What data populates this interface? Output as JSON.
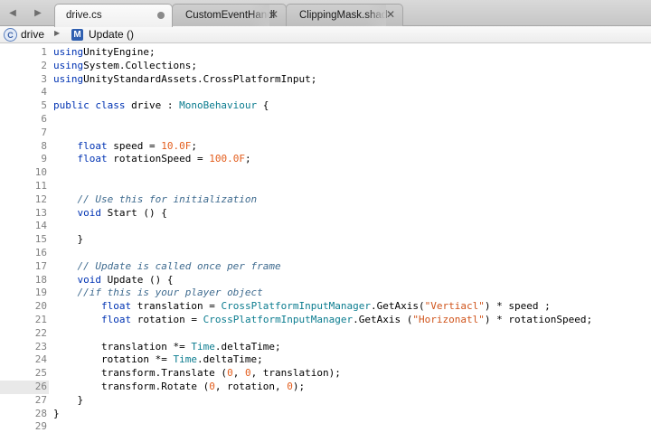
{
  "tabbar": {
    "nav_back_glyph": "◀",
    "nav_forward_glyph": "▶",
    "tabs": [
      {
        "title": "drive.cs",
        "active": true,
        "modified": true
      },
      {
        "title": "CustomEventHandl",
        "active": false,
        "close_glyph": "✕"
      },
      {
        "title": "ClippingMask.shad",
        "active": false,
        "close_glyph": "✕"
      }
    ]
  },
  "breadcrumb": {
    "class_icon_letter": "C",
    "class_name": "drive",
    "separator": "▶",
    "method_icon_letter": "M",
    "method_name": "Update ()"
  },
  "editor": {
    "current_line": 26,
    "colors": {
      "keyword": "#0033b3",
      "type": "#0b7c8f",
      "number": "#e35d1c",
      "string": "#d0541b",
      "comment": "#3f6b8f",
      "line_number": "#808080",
      "current_line_gutter": "#e9e9e9"
    },
    "lines": [
      {
        "n": "1",
        "tokens": [
          [
            "kw",
            "using"
          ],
          [
            "",
            "UnityEngine;"
          ]
        ]
      },
      {
        "n": "2",
        "tokens": [
          [
            "kw",
            "using"
          ],
          [
            "",
            "System.Collections;"
          ]
        ]
      },
      {
        "n": "3",
        "tokens": [
          [
            "kw",
            "using"
          ],
          [
            "",
            "UnityStandardAssets.CrossPlatformInput;"
          ]
        ]
      },
      {
        "n": "4",
        "tokens": []
      },
      {
        "n": "5",
        "tokens": [
          [
            "kw",
            "public class "
          ],
          [
            "",
            "drive : "
          ],
          [
            "type",
            "MonoBehaviour"
          ],
          [
            "",
            " {"
          ]
        ]
      },
      {
        "n": "6",
        "tokens": []
      },
      {
        "n": "7",
        "tokens": []
      },
      {
        "n": "8",
        "tokens": [
          [
            "",
            "    "
          ],
          [
            "kw",
            "float"
          ],
          [
            "",
            " speed = "
          ],
          [
            "num",
            "10.0F"
          ],
          [
            "",
            ";"
          ]
        ]
      },
      {
        "n": "9",
        "tokens": [
          [
            "",
            "    "
          ],
          [
            "kw",
            "float"
          ],
          [
            "",
            " rotationSpeed = "
          ],
          [
            "num",
            "100.0F"
          ],
          [
            "",
            ";"
          ]
        ]
      },
      {
        "n": "10",
        "tokens": []
      },
      {
        "n": "11",
        "tokens": []
      },
      {
        "n": "12",
        "tokens": [
          [
            "",
            "    "
          ],
          [
            "cm",
            "// Use this for initialization"
          ]
        ]
      },
      {
        "n": "13",
        "tokens": [
          [
            "",
            "    "
          ],
          [
            "kw",
            "void"
          ],
          [
            "",
            " Start () {"
          ]
        ]
      },
      {
        "n": "14",
        "tokens": []
      },
      {
        "n": "15",
        "tokens": [
          [
            "",
            "    }"
          ]
        ]
      },
      {
        "n": "16",
        "tokens": []
      },
      {
        "n": "17",
        "tokens": [
          [
            "",
            "    "
          ],
          [
            "cm",
            "// Update is called once per frame"
          ]
        ]
      },
      {
        "n": "18",
        "tokens": [
          [
            "",
            "    "
          ],
          [
            "kw",
            "void"
          ],
          [
            "",
            " Update () {"
          ]
        ]
      },
      {
        "n": "19",
        "tokens": [
          [
            "",
            "    "
          ],
          [
            "cm",
            "//if this is your player object"
          ]
        ]
      },
      {
        "n": "20",
        "tokens": [
          [
            "",
            "        "
          ],
          [
            "kw",
            "float"
          ],
          [
            "",
            " translation = "
          ],
          [
            "type",
            "CrossPlatformInputManager"
          ],
          [
            "",
            ".GetAxis("
          ],
          [
            "str",
            "\"Vertiacl\""
          ],
          [
            "",
            ") * speed ;"
          ]
        ]
      },
      {
        "n": "21",
        "tokens": [
          [
            "",
            "        "
          ],
          [
            "kw",
            "float"
          ],
          [
            "",
            " rotation = "
          ],
          [
            "type",
            "CrossPlatformInputManager"
          ],
          [
            "",
            ".GetAxis ("
          ],
          [
            "str",
            "\"Horizonatl\""
          ],
          [
            "",
            ") * rotationSpeed;"
          ]
        ]
      },
      {
        "n": "22",
        "tokens": []
      },
      {
        "n": "23",
        "tokens": [
          [
            "",
            "        translation *= "
          ],
          [
            "type",
            "Time"
          ],
          [
            "",
            ".deltaTime;"
          ]
        ]
      },
      {
        "n": "24",
        "tokens": [
          [
            "",
            "        rotation *= "
          ],
          [
            "type",
            "Time"
          ],
          [
            "",
            ".deltaTime;"
          ]
        ]
      },
      {
        "n": "25",
        "tokens": [
          [
            "",
            "        transform.Translate ("
          ],
          [
            "num",
            "0"
          ],
          [
            "",
            ", "
          ],
          [
            "num",
            "0"
          ],
          [
            "",
            ", translation);"
          ]
        ]
      },
      {
        "n": "26",
        "tokens": [
          [
            "",
            "        transform.Rotate ("
          ],
          [
            "num",
            "0"
          ],
          [
            "",
            ", rotation, "
          ],
          [
            "num",
            "0"
          ],
          [
            "",
            ");"
          ]
        ]
      },
      {
        "n": "27",
        "tokens": [
          [
            "",
            "    }"
          ]
        ]
      },
      {
        "n": "28",
        "tokens": [
          [
            "",
            "}"
          ]
        ]
      },
      {
        "n": "29",
        "tokens": []
      }
    ]
  }
}
